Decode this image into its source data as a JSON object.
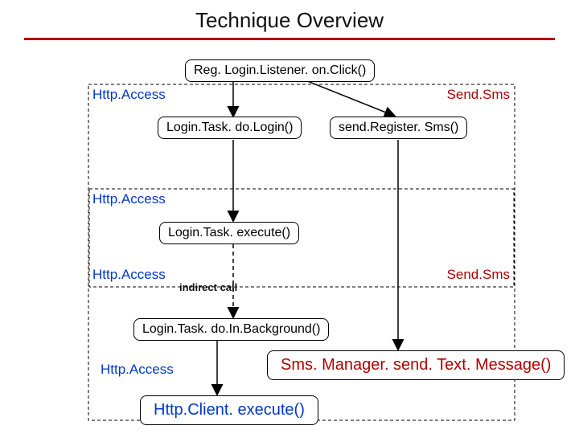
{
  "title": "Technique Overview",
  "nodes": {
    "root": "Reg. Login.Listener. on.Click()",
    "doLogin": "Login.Task. do.Login()",
    "sendRegister": "send.Register. Sms()",
    "execute": "Login.Task. execute()",
    "doInBackground": "Login.Task. do.In.Background()",
    "httpExecute": "Http.Client. execute()",
    "smsManager": "Sms. Manager. send. Text. Message()"
  },
  "sideLabels": {
    "httpAccess": "Http.Access",
    "sendSms": "Send.Sms"
  },
  "annotations": {
    "indirectCall": "indirect call"
  }
}
